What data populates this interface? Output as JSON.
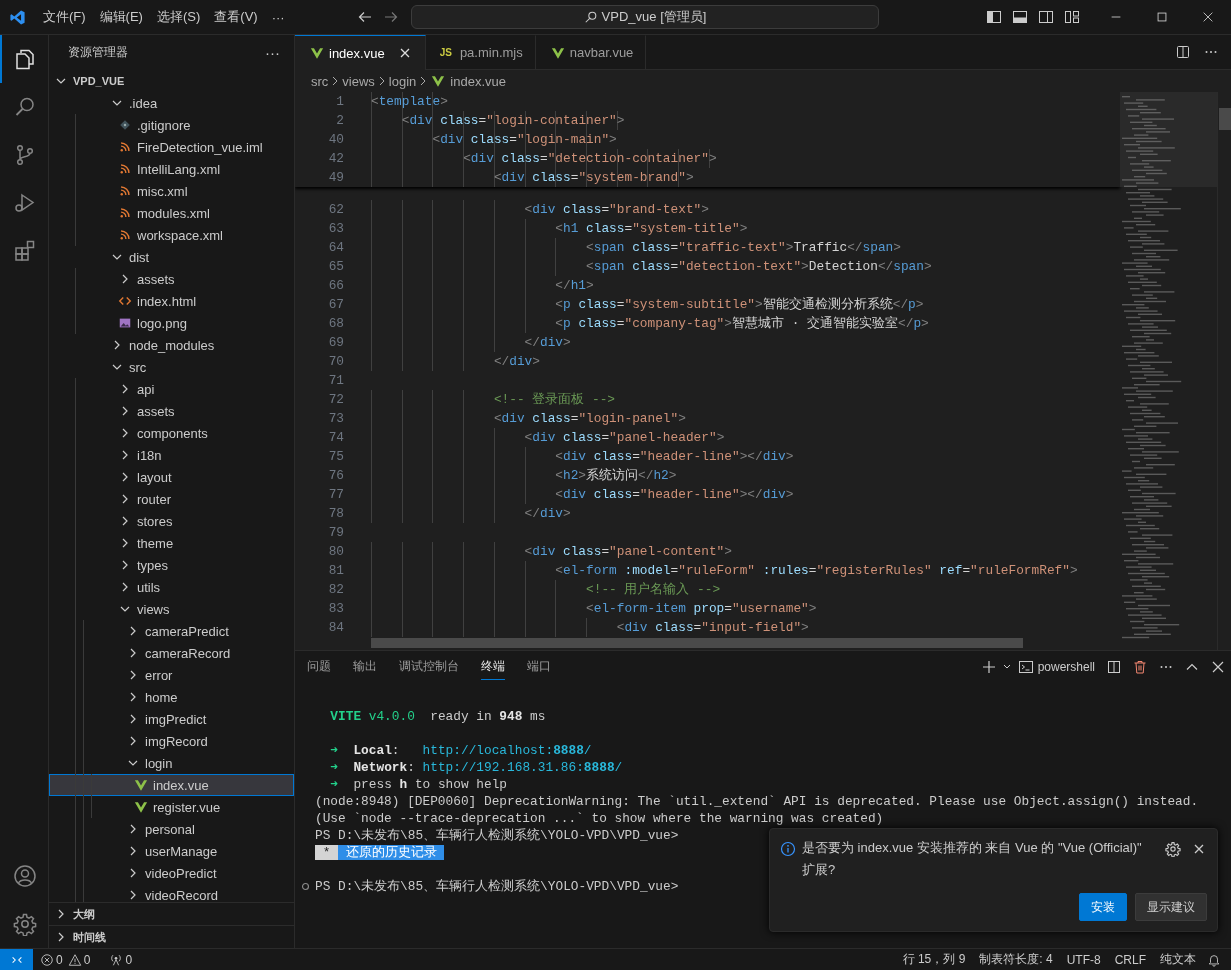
{
  "title_bar": {
    "menus": [
      "文件(F)",
      "编辑(E)",
      "选择(S)",
      "查看(V)"
    ],
    "more": "···",
    "search": "VPD_vue [管理员]"
  },
  "activity_bar": {
    "items": [
      {
        "kind": "explorer",
        "selected": true
      },
      {
        "kind": "search",
        "selected": false
      },
      {
        "kind": "source-control",
        "selected": false
      },
      {
        "kind": "run-debug",
        "selected": false
      },
      {
        "kind": "extensions",
        "selected": false
      }
    ],
    "bottom": [
      {
        "kind": "accounts"
      },
      {
        "kind": "settings"
      }
    ]
  },
  "sidebar": {
    "title": "资源管理器",
    "more": "···",
    "root": {
      "label": "VPD_VUE",
      "expanded": true,
      "children": [
        {
          "label": ".idea",
          "kind": "folder",
          "expanded": true,
          "selected": false,
          "children": [
            {
              "label": ".gitignore",
              "kind": "git",
              "selected": false
            },
            {
              "label": "FireDetection_vue.iml",
              "kind": "xml",
              "selected": false
            },
            {
              "label": "IntelliLang.xml",
              "kind": "xml",
              "selected": false
            },
            {
              "label": "misc.xml",
              "kind": "xml",
              "selected": false
            },
            {
              "label": "modules.xml",
              "kind": "xml",
              "selected": false
            },
            {
              "label": "workspace.xml",
              "kind": "xml",
              "selected": false
            }
          ]
        },
        {
          "label": "dist",
          "kind": "folder",
          "expanded": true,
          "selected": false,
          "children": [
            {
              "label": "assets",
              "kind": "folder",
              "expanded": false,
              "selected": false
            },
            {
              "label": "index.html",
              "kind": "html",
              "selected": false
            },
            {
              "label": "logo.png",
              "kind": "image",
              "selected": false
            }
          ]
        },
        {
          "label": "node_modules",
          "kind": "folder",
          "expanded": false,
          "selected": false
        },
        {
          "label": "src",
          "kind": "folder",
          "expanded": true,
          "selected": false,
          "children": [
            {
              "label": "api",
              "kind": "folder",
              "expanded": false,
              "selected": false
            },
            {
              "label": "assets",
              "kind": "folder",
              "expanded": false,
              "selected": false
            },
            {
              "label": "components",
              "kind": "folder",
              "expanded": false,
              "selected": false
            },
            {
              "label": "i18n",
              "kind": "folder",
              "expanded": false,
              "selected": false
            },
            {
              "label": "layout",
              "kind": "folder",
              "expanded": false,
              "selected": false
            },
            {
              "label": "router",
              "kind": "folder",
              "expanded": false,
              "selected": false
            },
            {
              "label": "stores",
              "kind": "folder",
              "expanded": false,
              "selected": false
            },
            {
              "label": "theme",
              "kind": "folder",
              "expanded": false,
              "selected": false
            },
            {
              "label": "types",
              "kind": "folder",
              "expanded": false,
              "selected": false
            },
            {
              "label": "utils",
              "kind": "folder",
              "expanded": false,
              "selected": false
            },
            {
              "label": "views",
              "kind": "folder",
              "expanded": true,
              "selected": false,
              "children": [
                {
                  "label": "cameraPredict",
                  "kind": "folder",
                  "expanded": false,
                  "selected": false
                },
                {
                  "label": "cameraRecord",
                  "kind": "folder",
                  "expanded": false,
                  "selected": false
                },
                {
                  "label": "error",
                  "kind": "folder",
                  "expanded": false,
                  "selected": false
                },
                {
                  "label": "home",
                  "kind": "folder",
                  "expanded": false,
                  "selected": false
                },
                {
                  "label": "imgPredict",
                  "kind": "folder",
                  "expanded": false,
                  "selected": false
                },
                {
                  "label": "imgRecord",
                  "kind": "folder",
                  "expanded": false,
                  "selected": false
                },
                {
                  "label": "login",
                  "kind": "folder",
                  "expanded": true,
                  "selected": false,
                  "children": [
                    {
                      "label": "index.vue",
                      "kind": "vue",
                      "selected": true
                    },
                    {
                      "label": "register.vue",
                      "kind": "vue",
                      "selected": false
                    }
                  ]
                },
                {
                  "label": "personal",
                  "kind": "folder",
                  "expanded": false,
                  "selected": false
                },
                {
                  "label": "userManage",
                  "kind": "folder",
                  "expanded": false,
                  "selected": false
                },
                {
                  "label": "videoPredict",
                  "kind": "folder",
                  "expanded": false,
                  "selected": false
                },
                {
                  "label": "videoRecord",
                  "kind": "folder",
                  "expanded": false,
                  "selected": false
                }
              ]
            }
          ]
        }
      ]
    },
    "sections": [
      {
        "label": "大纲",
        "expanded": false
      },
      {
        "label": "时间线",
        "expanded": false
      }
    ]
  },
  "editor": {
    "tabs": [
      {
        "label": "index.vue",
        "kind": "vue",
        "selected": true
      },
      {
        "label": "pa.min.mjs",
        "kind": "js",
        "badge": "JS",
        "selected": false
      },
      {
        "label": "navbar.vue",
        "kind": "vue",
        "selected": false
      }
    ],
    "breadcrumb": [
      {
        "label": "src",
        "kind": "folder"
      },
      {
        "label": "views",
        "kind": "folder"
      },
      {
        "label": "login",
        "kind": "folder"
      },
      {
        "label": "index.vue",
        "kind": "vue"
      }
    ],
    "sticky_lines": [
      {
        "number": "1",
        "text": "<template>"
      },
      {
        "number": "2",
        "text": "    <div class=\"login-container\">"
      },
      {
        "number": "40",
        "text": "        <div class=\"login-main\">"
      },
      {
        "number": "42",
        "text": "            <div class=\"detection-container\">"
      },
      {
        "number": "49",
        "text": "                <div class=\"system-brand\">"
      }
    ],
    "lines": [
      {
        "number": "62",
        "text": "                    <div class=\"brand-text\">"
      },
      {
        "number": "63",
        "text": "                        <h1 class=\"system-title\">"
      },
      {
        "number": "64",
        "text": "                            <span class=\"traffic-text\">Traffic</span>"
      },
      {
        "number": "65",
        "text": "                            <span class=\"detection-text\">Detection</span>"
      },
      {
        "number": "66",
        "text": "                        </h1>"
      },
      {
        "number": "67",
        "text": "                        <p class=\"system-subtitle\">智能交通检测分析系统</p>"
      },
      {
        "number": "68",
        "text": "                        <p class=\"company-tag\">智慧城市 · 交通智能实验室</p>"
      },
      {
        "number": "69",
        "text": "                    </div>"
      },
      {
        "number": "70",
        "text": "                </div>"
      },
      {
        "number": "71"
      },
      {
        "number": "72",
        "text": "                <!-- 登录面板 -->"
      },
      {
        "number": "73",
        "text": "                <div class=\"login-panel\">"
      },
      {
        "number": "74",
        "text": "                    <div class=\"panel-header\">"
      },
      {
        "number": "75",
        "text": "                        <div class=\"header-line\"></div>"
      },
      {
        "number": "76",
        "text": "                        <h2>系统访问</h2>"
      },
      {
        "number": "77",
        "text": "                        <div class=\"header-line\"></div>"
      },
      {
        "number": "78",
        "text": "                    </div>"
      },
      {
        "number": "79"
      },
      {
        "number": "80",
        "text": "                    <div class=\"panel-content\">"
      },
      {
        "number": "81",
        "text": "                        <el-form :model=\"ruleForm\" :rules=\"registerRules\" ref=\"ruleFormRef\">"
      },
      {
        "number": "82",
        "text": "                            <!-- 用户名输入 -->"
      },
      {
        "number": "83",
        "text": "                            <el-form-item prop=\"username\">"
      },
      {
        "number": "84",
        "text": "                                <div class=\"input-field\">"
      }
    ]
  },
  "panel": {
    "tabs": [
      {
        "label": "问题",
        "selected": false
      },
      {
        "label": "输出",
        "selected": false
      },
      {
        "label": "调试控制台",
        "selected": false
      },
      {
        "label": "终端",
        "selected": true
      },
      {
        "label": "端口",
        "selected": false
      }
    ],
    "shell": "powershell",
    "terminal": [
      {
        "kind": "blank"
      },
      {
        "kind": "text",
        "segments": [
          {
            "text": "  VITE",
            "kind": "green-bold"
          },
          {
            "text": " v4.0.0",
            "kind": "green"
          },
          {
            "text": "  ready in ",
            "kind": "plain"
          },
          {
            "text": "948",
            "kind": "bold"
          },
          {
            "text": " ms",
            "kind": "plain"
          }
        ]
      },
      {
        "kind": "blank"
      },
      {
        "kind": "text",
        "segments": [
          {
            "text": "  ➜  ",
            "kind": "green"
          },
          {
            "text": "Local",
            "kind": "bold"
          },
          {
            "text": ":   ",
            "kind": "plain"
          },
          {
            "text": "http://localhost:",
            "kind": "cyan"
          },
          {
            "text": "8888",
            "kind": "cyan-bold"
          },
          {
            "text": "/",
            "kind": "cyan"
          }
        ]
      },
      {
        "kind": "text",
        "segments": [
          {
            "text": "  ➜  ",
            "kind": "green"
          },
          {
            "text": "Network",
            "kind": "bold"
          },
          {
            "text": ": ",
            "kind": "plain"
          },
          {
            "text": "http://192.168.31.86:",
            "kind": "cyan"
          },
          {
            "text": "8888",
            "kind": "cyan-bold"
          },
          {
            "text": "/",
            "kind": "cyan"
          }
        ]
      },
      {
        "kind": "text",
        "segments": [
          {
            "text": "  ➜  ",
            "kind": "green"
          },
          {
            "text": "press ",
            "kind": "plain"
          },
          {
            "text": "h",
            "kind": "bold"
          },
          {
            "text": " to show help",
            "kind": "plain"
          }
        ]
      },
      {
        "kind": "text",
        "segments": [
          {
            "text": "(node:8948) [DEP0060] DeprecationWarning: The `util._extend` API is deprecated. Please use Object.assign() instead.",
            "kind": "plain"
          }
        ]
      },
      {
        "kind": "text",
        "segments": [
          {
            "text": "(Use `node --trace-deprecation ...` to show where the warning was created)",
            "kind": "plain"
          }
        ]
      },
      {
        "kind": "text",
        "segments": [
          {
            "text": "PS D:\\未发布\\85、车辆行人检测系统\\YOLO-VPD\\VPD_vue>",
            "kind": "plain"
          }
        ]
      },
      {
        "kind": "text",
        "segments": [
          {
            "text": " * ",
            "kind": "history-mark"
          },
          {
            "text": " 还原的历史记录 ",
            "kind": "history"
          }
        ]
      },
      {
        "kind": "blank"
      },
      {
        "kind": "decorated",
        "segments": [
          {
            "text": "PS D:\\未发布\\85、车辆行人检测系统\\YOLO-VPD\\VPD_vue>",
            "kind": "plain"
          }
        ]
      }
    ],
    "notification": {
      "message": "是否要为 index.vue 安装推荐的 来自 Vue 的 \"Vue (Official)\" 扩展?",
      "buttons": [
        {
          "label": "安装",
          "kind": "primary"
        },
        {
          "label": "显示建议",
          "kind": "secondary"
        }
      ]
    }
  },
  "status_bar": {
    "errors": "0",
    "warnings": "0",
    "ports": "0",
    "items": [
      "行 15，列 9",
      "制表符长度: 4",
      "UTF-8",
      "CRLF",
      "纯文本"
    ]
  }
}
